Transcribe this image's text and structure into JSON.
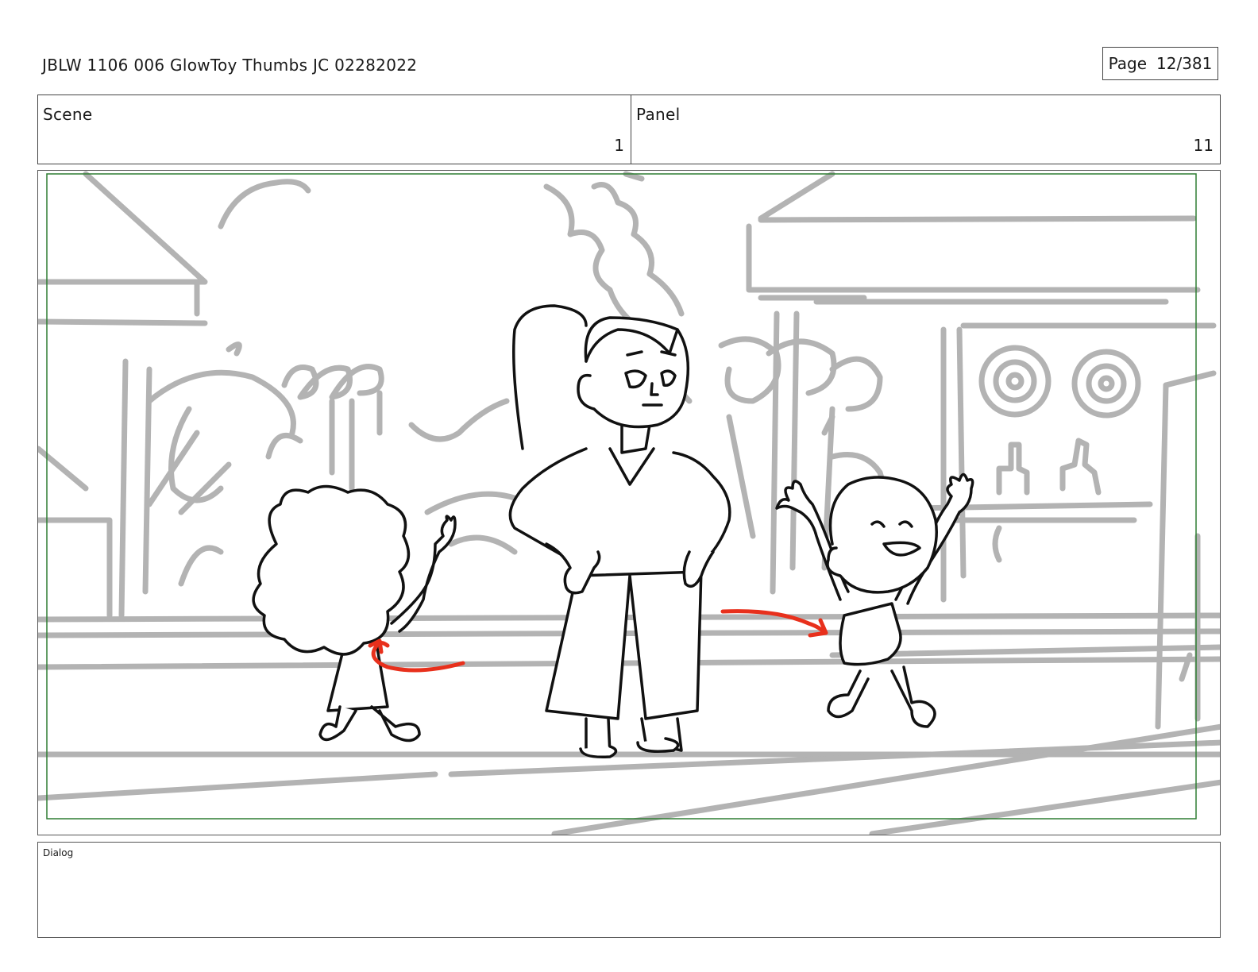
{
  "header": {
    "title": "JBLW 1106 006 GlowToy Thumbs JC 02282022",
    "page_label": "Page",
    "page_number": "12/381"
  },
  "info": {
    "scene_label": "Scene",
    "scene_value": "1",
    "panel_label": "Panel",
    "panel_value": "11"
  },
  "panel_image": {
    "description_icon": "storyboard-sketch",
    "colors": {
      "background_lines": "#b3b3b3",
      "character_lines": "#111111",
      "motion_arrows": "#e8301c",
      "safe_frame": "#2e7d32"
    }
  },
  "dialog": {
    "label": "Dialog",
    "text": ""
  }
}
